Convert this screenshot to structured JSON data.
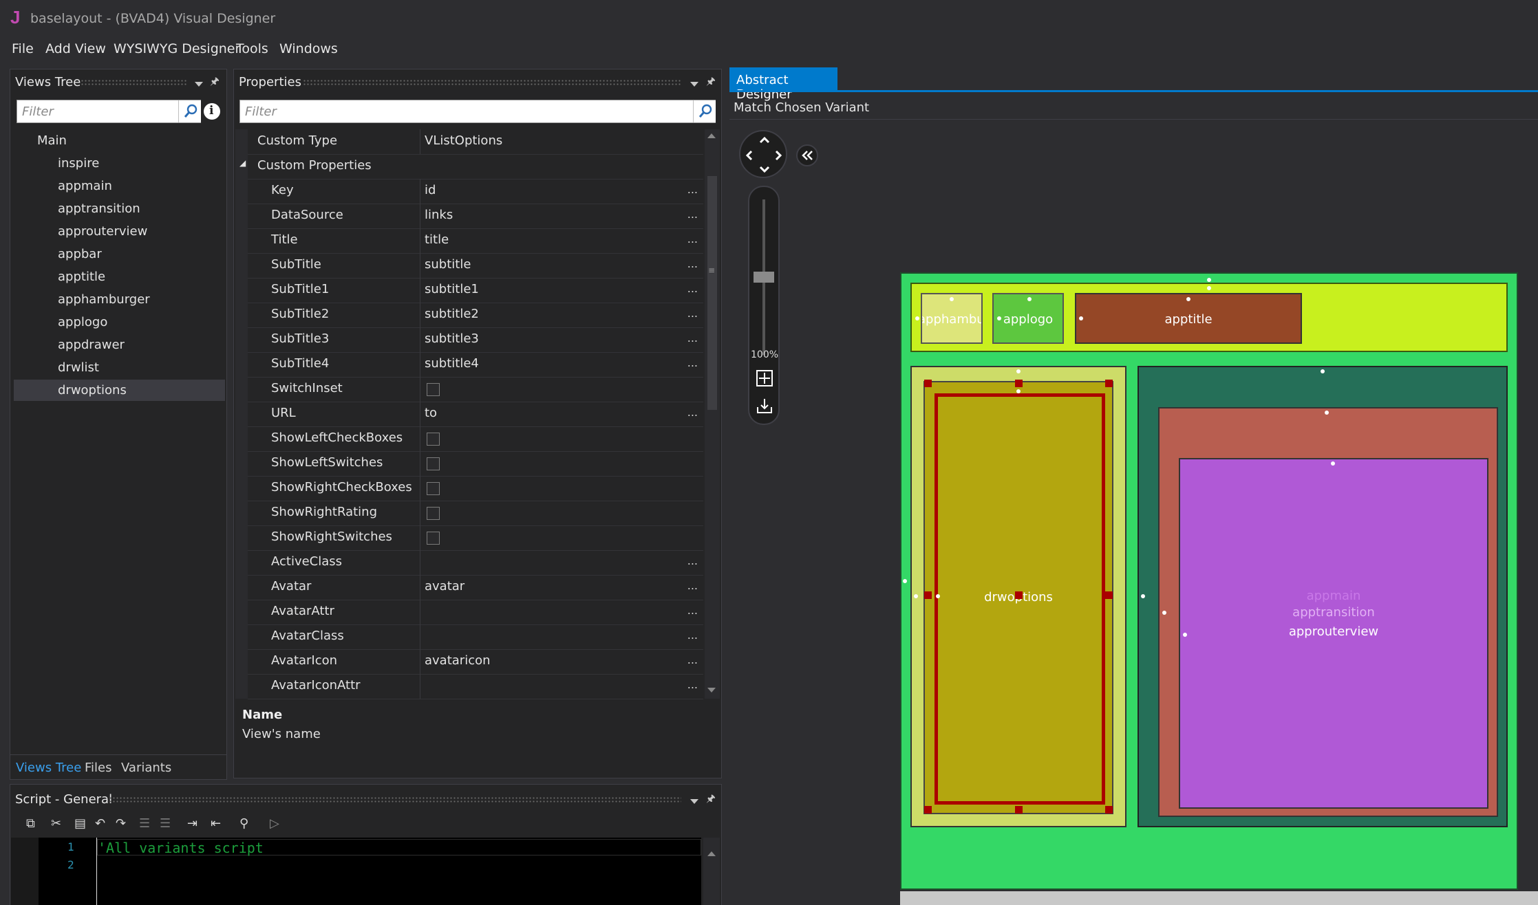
{
  "window": {
    "title": "baselayout - (BVAD4) Visual Designer",
    "app_icon": "J"
  },
  "menu": [
    "File",
    "Add View",
    "WYSIWYG Designer",
    "Tools",
    "Windows"
  ],
  "views_tree": {
    "title": "Views Tree",
    "filter_placeholder": "Filter",
    "root": "Main",
    "items": [
      "inspire",
      "appmain",
      "apptransition",
      "approuterview",
      "appbar",
      "apptitle",
      "apphamburger",
      "applogo",
      "appdrawer",
      "drwlist",
      "drwoptions"
    ],
    "selected": "drwoptions",
    "tabs": [
      "Views Tree",
      "Files",
      "Variants"
    ],
    "active_tab": "Views Tree"
  },
  "properties": {
    "title": "Properties",
    "filter_placeholder": "Filter",
    "rows": [
      {
        "name": "Custom Type",
        "value": "VListOptions",
        "kind": "text"
      },
      {
        "name": "Custom Properties",
        "value": "",
        "kind": "section"
      },
      {
        "name": "Key",
        "value": "id",
        "kind": "text",
        "dots": "..."
      },
      {
        "name": "DataSource",
        "value": "links",
        "kind": "text",
        "dots": "..."
      },
      {
        "name": "Title",
        "value": "title",
        "kind": "text",
        "dots": "..."
      },
      {
        "name": "SubTitle",
        "value": "subtitle",
        "kind": "text",
        "dots": "..."
      },
      {
        "name": "SubTitle1",
        "value": "subtitle1",
        "kind": "text",
        "dots": "..."
      },
      {
        "name": "SubTitle2",
        "value": "subtitle2",
        "kind": "text",
        "dots": "..."
      },
      {
        "name": "SubTitle3",
        "value": "subtitle3",
        "kind": "text",
        "dots": "..."
      },
      {
        "name": "SubTitle4",
        "value": "subtitle4",
        "kind": "text",
        "dots": "..."
      },
      {
        "name": "SwitchInset",
        "value": "",
        "kind": "check"
      },
      {
        "name": "URL",
        "value": "to",
        "kind": "text",
        "dots": "..."
      },
      {
        "name": "ShowLeftCheckBoxes",
        "value": "",
        "kind": "check"
      },
      {
        "name": "ShowLeftSwitches",
        "value": "",
        "kind": "check"
      },
      {
        "name": "ShowRightCheckBoxes",
        "value": "",
        "kind": "check"
      },
      {
        "name": "ShowRightRating",
        "value": "",
        "kind": "check"
      },
      {
        "name": "ShowRightSwitches",
        "value": "",
        "kind": "check"
      },
      {
        "name": "ActiveClass",
        "value": "",
        "kind": "text",
        "dots": "..."
      },
      {
        "name": "Avatar",
        "value": "avatar",
        "kind": "text",
        "dots": "..."
      },
      {
        "name": "AvatarAttr",
        "value": "",
        "kind": "text",
        "dots": "..."
      },
      {
        "name": "AvatarClass",
        "value": "",
        "kind": "text",
        "dots": "..."
      },
      {
        "name": "AvatarIcon",
        "value": "avataricon",
        "kind": "text",
        "dots": "..."
      },
      {
        "name": "AvatarIconAttr",
        "value": "",
        "kind": "text",
        "dots": "..."
      }
    ],
    "description_title": "Name",
    "description_text": "View's name"
  },
  "script": {
    "title": "Script - General",
    "lines": [
      "'All variants script",
      ""
    ],
    "line_numbers": [
      "1",
      "2"
    ]
  },
  "designer": {
    "tab": "Abstract Designer",
    "variant_label": "Match Chosen Variant",
    "zoom": "100%",
    "zoom_level": 0.5,
    "views": {
      "hamburger": "apphamburger",
      "logo": "applogo",
      "title": "apptitle",
      "drwoptions": "drwoptions",
      "appmain": "appmain",
      "apptransition": "apptransition",
      "approuterview": "approuterview"
    },
    "colors": {
      "main_bg": "#34d866",
      "appbar": "#c8f01e",
      "hamburger": "#dde57a",
      "logo": "#5dc73f",
      "title": "#954726",
      "drawer": "#cddc68",
      "drwoptions": "#b3a60f",
      "appmain": "#256f58",
      "apptransition": "#b85e50",
      "approuterview": "#b059d6",
      "selection": "#aa0000"
    }
  }
}
